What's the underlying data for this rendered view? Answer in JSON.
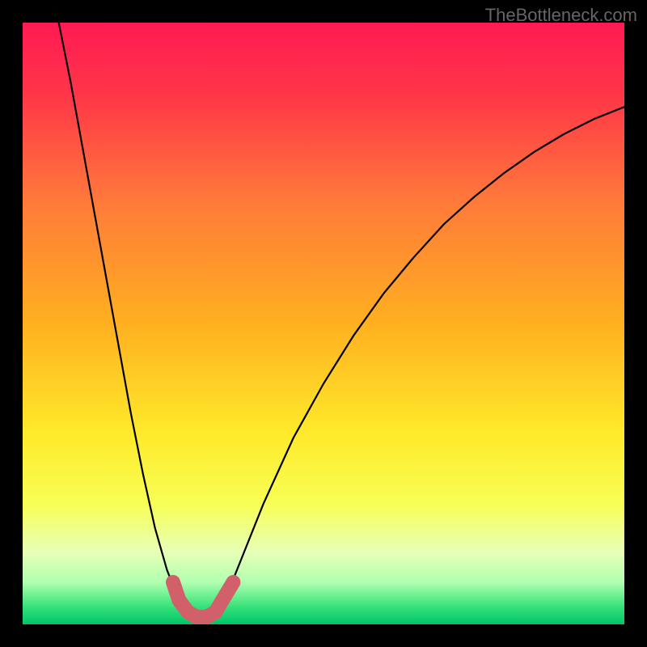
{
  "watermark": "TheBottleneck.com",
  "chart_data": {
    "type": "line",
    "title": "",
    "xlabel": "",
    "ylabel": "",
    "xlim": [
      0,
      100
    ],
    "ylim": [
      0,
      100
    ],
    "background_gradient": {
      "stops": [
        {
          "pos": 0.0,
          "color": "#ff1a53"
        },
        {
          "pos": 0.12,
          "color": "#ff3648"
        },
        {
          "pos": 0.3,
          "color": "#ff7a3a"
        },
        {
          "pos": 0.5,
          "color": "#ffb020"
        },
        {
          "pos": 0.68,
          "color": "#ffe92a"
        },
        {
          "pos": 0.8,
          "color": "#f7ff55"
        },
        {
          "pos": 0.88,
          "color": "#e8ffb8"
        },
        {
          "pos": 0.93,
          "color": "#b0ffb0"
        },
        {
          "pos": 0.97,
          "color": "#38e27a"
        },
        {
          "pos": 1.0,
          "color": "#00c46a"
        }
      ]
    },
    "series": [
      {
        "name": "bottleneck-curve",
        "type": "line",
        "points": [
          {
            "x": 6.0,
            "y": 100.0
          },
          {
            "x": 8.0,
            "y": 90.0
          },
          {
            "x": 10.0,
            "y": 79.0
          },
          {
            "x": 12.0,
            "y": 68.0
          },
          {
            "x": 14.0,
            "y": 57.0
          },
          {
            "x": 16.0,
            "y": 46.0
          },
          {
            "x": 18.0,
            "y": 35.0
          },
          {
            "x": 20.0,
            "y": 25.0
          },
          {
            "x": 22.0,
            "y": 16.0
          },
          {
            "x": 24.0,
            "y": 9.0
          },
          {
            "x": 26.0,
            "y": 4.0
          },
          {
            "x": 28.0,
            "y": 1.5
          },
          {
            "x": 30.0,
            "y": 1.0
          },
          {
            "x": 32.0,
            "y": 2.0
          },
          {
            "x": 34.0,
            "y": 5.0
          },
          {
            "x": 36.0,
            "y": 10.0
          },
          {
            "x": 40.0,
            "y": 20.0
          },
          {
            "x": 45.0,
            "y": 31.0
          },
          {
            "x": 50.0,
            "y": 40.0
          },
          {
            "x": 55.0,
            "y": 48.0
          },
          {
            "x": 60.0,
            "y": 55.0
          },
          {
            "x": 65.0,
            "y": 61.0
          },
          {
            "x": 70.0,
            "y": 66.5
          },
          {
            "x": 75.0,
            "y": 71.0
          },
          {
            "x": 80.0,
            "y": 75.0
          },
          {
            "x": 85.0,
            "y": 78.5
          },
          {
            "x": 90.0,
            "y": 81.5
          },
          {
            "x": 95.0,
            "y": 84.0
          },
          {
            "x": 100.0,
            "y": 86.0
          }
        ]
      },
      {
        "name": "optimal-zone-highlight",
        "type": "line",
        "color": "#d1606a",
        "points": [
          {
            "x": 25.0,
            "y": 7.0
          },
          {
            "x": 26.0,
            "y": 4.0
          },
          {
            "x": 27.5,
            "y": 2.0
          },
          {
            "x": 29.0,
            "y": 1.2
          },
          {
            "x": 30.5,
            "y": 1.2
          },
          {
            "x": 32.0,
            "y": 2.0
          },
          {
            "x": 33.5,
            "y": 4.5
          },
          {
            "x": 35.0,
            "y": 7.0
          }
        ]
      }
    ]
  }
}
